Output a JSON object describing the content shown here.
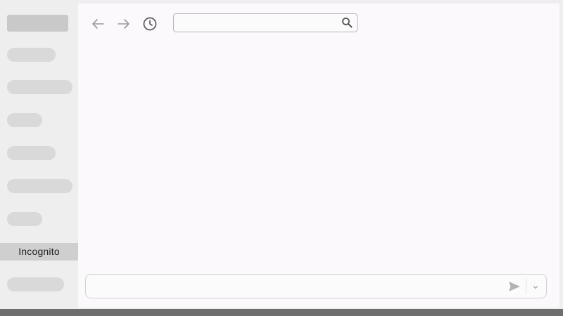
{
  "sidebar": {
    "active_item_label": "Incognito",
    "placeholder_item_count": 9
  },
  "toolbar": {
    "icons": [
      "arrow-left-icon",
      "arrow-right-icon",
      "history-clock-icon"
    ],
    "address_value": "",
    "address_placeholder": "",
    "search_icon": "magnifier-icon"
  },
  "composer": {
    "value": "",
    "placeholder": "",
    "send_icon": "paper-plane-icon",
    "options_icon": "chevron-down-icon"
  },
  "colors": {
    "window_background": "#efeeef",
    "content_background": "#fbf9fb",
    "active_item_background": "#cfcfcf",
    "skeleton": "#d9d9d9",
    "taskbar": "#6e6e6e"
  }
}
